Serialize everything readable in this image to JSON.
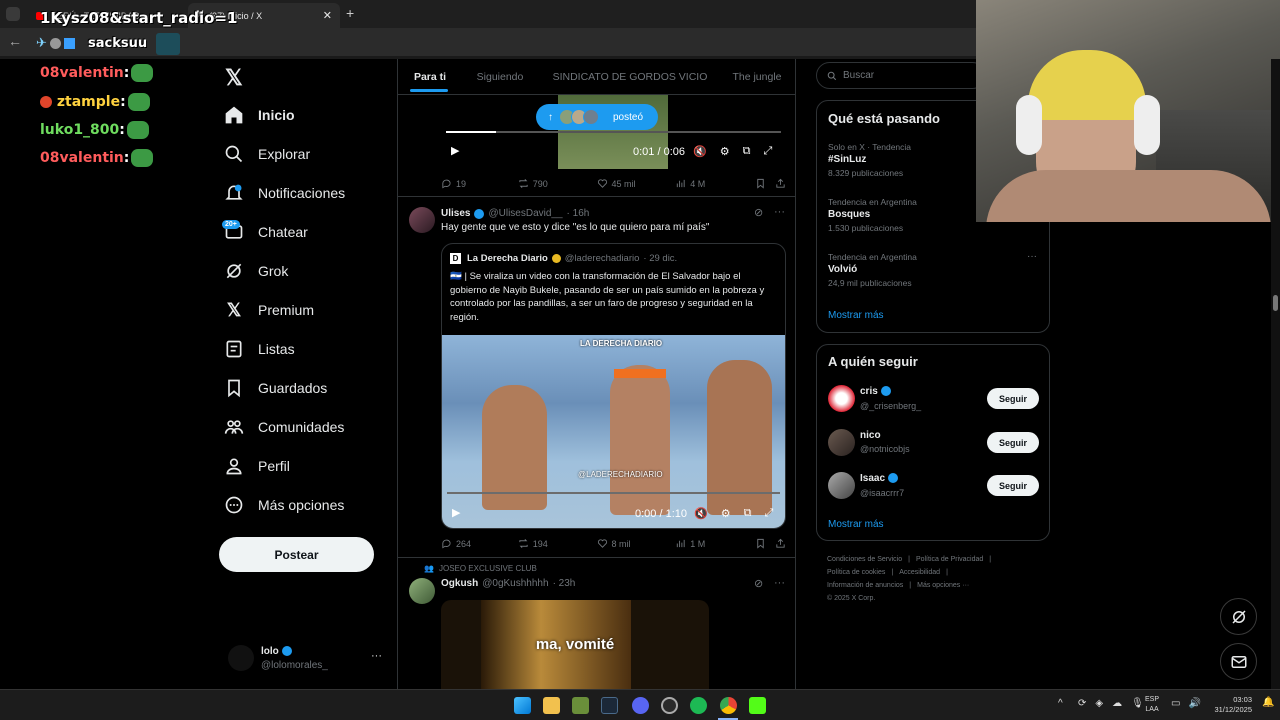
{
  "browser": {
    "tabs": [
      {
        "label": "PERÚ - TERMINIDAD",
        "active": false
      },
      {
        "label": "(37) Inicio / X",
        "active": true
      }
    ],
    "new_tab": "+"
  },
  "overlay": {
    "top_text": "1Kysz08&start_radio=1",
    "streamer_name": "sacksuu",
    "chat": [
      {
        "user": "08valentin",
        "color": "#ff5c5c"
      },
      {
        "user": "ztample",
        "color": "#ffd23f"
      },
      {
        "user": "luko1_800",
        "color": "#6fdc5f"
      },
      {
        "user": "08valentin",
        "color": "#ff5c5c"
      }
    ]
  },
  "sidebar": {
    "items": [
      {
        "label": "Inicio",
        "icon": "home-icon"
      },
      {
        "label": "Explorar",
        "icon": "search-icon"
      },
      {
        "label": "Notificaciones",
        "icon": "bell-icon"
      },
      {
        "label": "Chatear",
        "icon": "chat-icon",
        "badge": "20+"
      },
      {
        "label": "Grok",
        "icon": "grok-icon"
      },
      {
        "label": "Premium",
        "icon": "x-logo-icon"
      },
      {
        "label": "Listas",
        "icon": "list-icon"
      },
      {
        "label": "Guardados",
        "icon": "bookmark-icon"
      },
      {
        "label": "Comunidades",
        "icon": "communities-icon"
      },
      {
        "label": "Perfil",
        "icon": "person-icon"
      },
      {
        "label": "Más opciones",
        "icon": "more-circle-icon"
      }
    ],
    "post_label": "Postear",
    "account": {
      "name": "lolo",
      "handle": "@lolomorales_",
      "more": "···"
    }
  },
  "feed": {
    "tabs": [
      "Para ti",
      "Siguiendo",
      "SINDICATO DE GORDOS VICIO",
      "The jungle"
    ],
    "new_posts_pill": "posteó",
    "tweet0": {
      "video_time": "0:01 / 0:06",
      "replies": "19",
      "reposts": "790",
      "likes": "45 mil",
      "views": "4 M"
    },
    "tweet1": {
      "name": "Ulises",
      "handle": "@UlisesDavid__",
      "time": "· 16h",
      "text": "Hay gente que ve esto y dice \"es lo que quiero para mí país\"",
      "quote": {
        "name": "La Derecha Diario",
        "handle": "@laderechadiario",
        "time": "· 29 dic.",
        "text": "🇸🇻 | Se viraliza un video con la transformación de El Salvador bajo el gobierno de Nayib Bukele, pasando de ser un país sumido en la pobreza y controlado por las pandillas, a ser un faro de progreso y seguridad en la región."
      },
      "video_watermark": "LA DERECHA DIARIO",
      "video_tag": "@LADERECHADIARIO",
      "video_time": "0:00 / 1:10",
      "replies": "264",
      "reposts": "194",
      "likes": "8 mil",
      "views": "1 M"
    },
    "tweet2": {
      "community": "JOSEO EXCLUSIVE CLUB",
      "name": "Ogkush",
      "handle": "@0gKushhhhh",
      "time": "· 23h",
      "media_caption": "ma, vomité"
    }
  },
  "right": {
    "search_placeholder": "Buscar",
    "trends_title": "Qué está pasando",
    "trends": [
      {
        "meta": "Solo en X · Tendencia",
        "title": "#SinLuz",
        "count": "8.329 publicaciones"
      },
      {
        "meta": "Tendencia en Argentina",
        "title": "Bosques",
        "count": "1.530 publicaciones"
      },
      {
        "meta": "Tendencia en Argentina",
        "title": "Volvió",
        "count": "24,9 mil publicaciones"
      }
    ],
    "show_more": "Mostrar más",
    "follow_title": "A quién seguir",
    "follow": [
      {
        "name": "cris",
        "handle": "@_crisenberg_",
        "verified": true
      },
      {
        "name": "nico",
        "handle": "@notnicobjs",
        "verified": false
      },
      {
        "name": "Isaac",
        "handle": "@isaacrrr7",
        "verified": true
      }
    ],
    "follow_btn": "Seguir",
    "footer": {
      "links": [
        "Condiciones de Servicio",
        "Política de Privacidad",
        "Política de cookies",
        "Accesibilidad",
        "Información de anuncios",
        "Más opciones ···"
      ],
      "copyright": "© 2025 X Corp."
    }
  },
  "taskbar": {
    "lang": "ESP",
    "region": "LAA",
    "time": "03:03",
    "date": "31/12/2025"
  },
  "colors": {
    "x_blue": "#1d9bf0",
    "background": "#000000",
    "border": "#2f3336",
    "muted": "#71767b"
  }
}
